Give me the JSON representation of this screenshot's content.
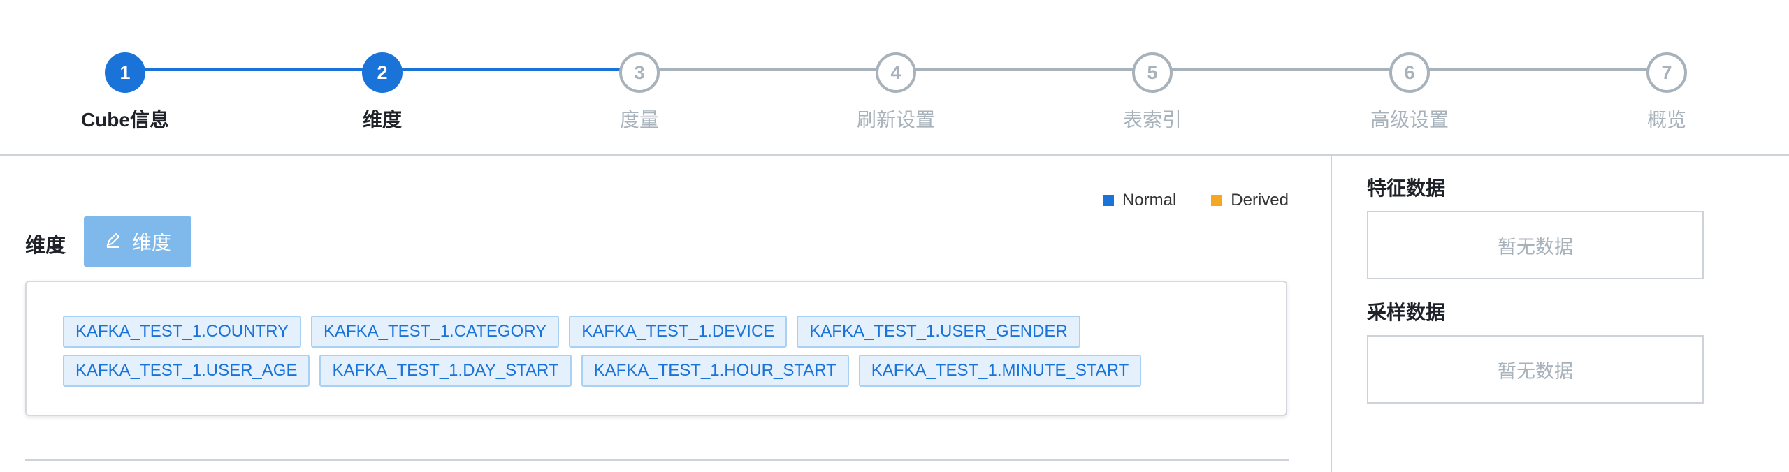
{
  "steps": [
    {
      "number": "1",
      "label": "Cube信息",
      "state": "active"
    },
    {
      "number": "2",
      "label": "维度",
      "state": "active"
    },
    {
      "number": "3",
      "label": "度量",
      "state": "inactive"
    },
    {
      "number": "4",
      "label": "刷新设置",
      "state": "inactive"
    },
    {
      "number": "5",
      "label": "表索引",
      "state": "inactive"
    },
    {
      "number": "6",
      "label": "高级设置",
      "state": "inactive"
    },
    {
      "number": "7",
      "label": "概览",
      "state": "inactive"
    }
  ],
  "legend": {
    "normal": {
      "label": "Normal",
      "color": "#1a73d8"
    },
    "derived": {
      "label": "Derived",
      "color": "#f5a623"
    }
  },
  "dimensions": {
    "label": "维度",
    "button_label": "维度",
    "button_icon": "edit-icon",
    "tags_row1": [
      "KAFKA_TEST_1.COUNTRY",
      "KAFKA_TEST_1.CATEGORY",
      "KAFKA_TEST_1.DEVICE",
      "KAFKA_TEST_1.USER_GENDER"
    ],
    "tags_row2": [
      "KAFKA_TEST_1.USER_AGE",
      "KAFKA_TEST_1.DAY_START",
      "KAFKA_TEST_1.HOUR_START",
      "KAFKA_TEST_1.MINUTE_START"
    ]
  },
  "side_panel": {
    "feature_title": "特征数据",
    "feature_empty": "暂无数据",
    "sample_title": "采样数据",
    "sample_empty": "暂无数据"
  }
}
